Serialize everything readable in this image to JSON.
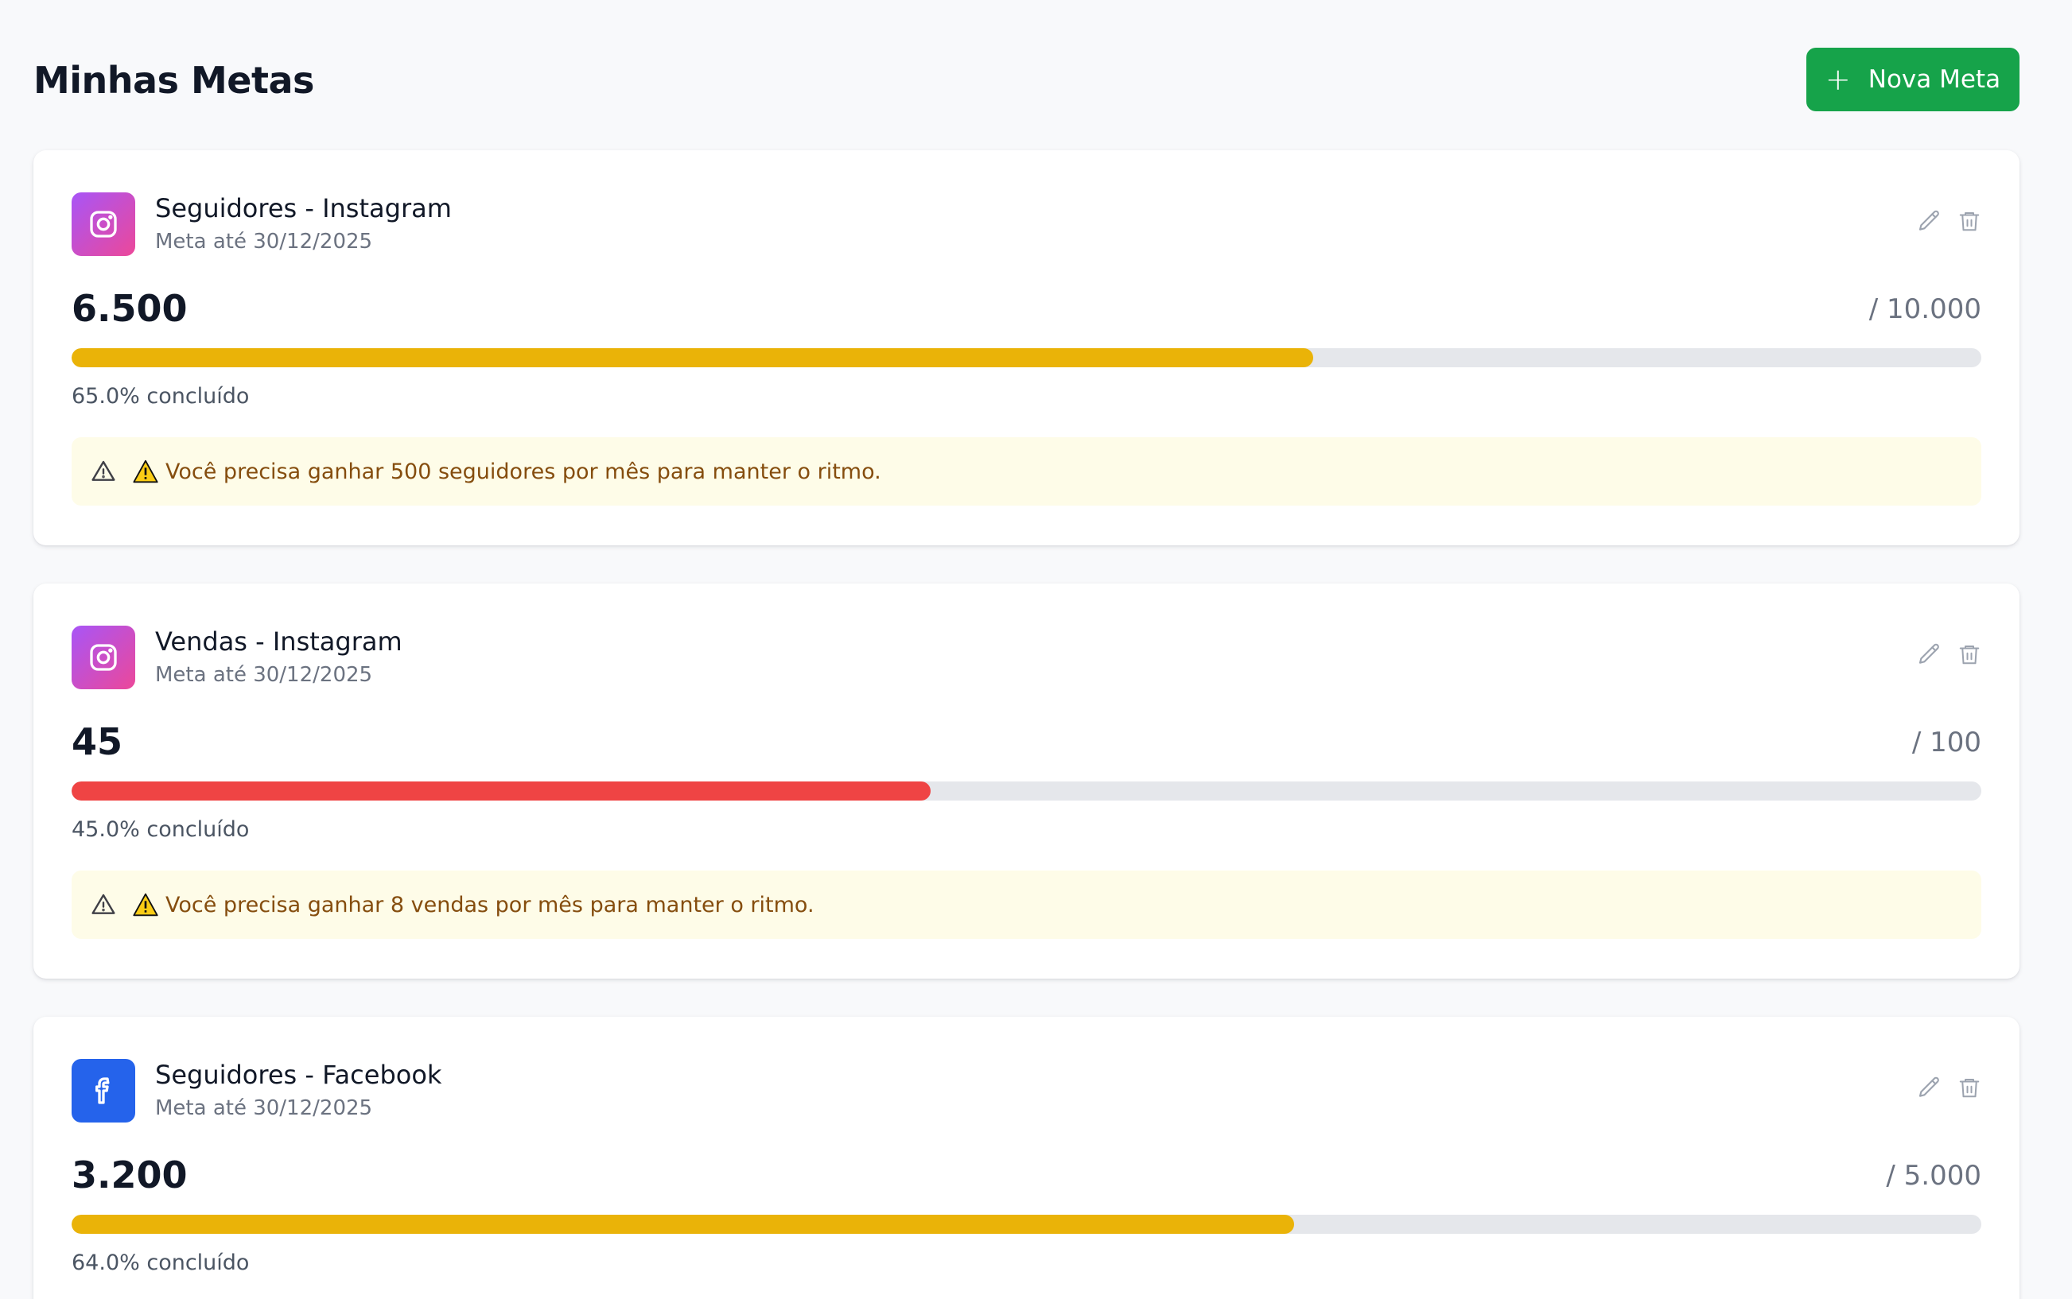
{
  "header": {
    "title": "Minhas Metas",
    "new_button_label": "Nova Meta",
    "new_button_icon": "plus-icon"
  },
  "colors": {
    "primary_green": "#16a34a",
    "progress_yellow": "#eab308",
    "progress_red": "#ef4444",
    "track_gray": "#e5e7eb",
    "alert_bg": "#fefce8",
    "alert_text": "#854d0e",
    "facebook_blue": "#2563eb"
  },
  "goals": [
    {
      "title": "Seguidores - Instagram",
      "subtitle": "Meta até 30/12/2025",
      "platform_icon": "instagram-icon",
      "current": "6.500",
      "target": "/ 10.000",
      "progress": 0.65,
      "progress_color": "#eab308",
      "progress_label": "65.0% concluído",
      "alert": "Você precisa ganhar 500 seguidores por mês para manter o ritmo."
    },
    {
      "title": "Vendas - Instagram",
      "subtitle": "Meta até 30/12/2025",
      "platform_icon": "instagram-icon",
      "current": "45",
      "target": "/ 100",
      "progress": 0.45,
      "progress_color": "#ef4444",
      "progress_label": "45.0% concluído",
      "alert": "Você precisa ganhar 8 vendas por mês para manter o ritmo."
    },
    {
      "title": "Seguidores - Facebook",
      "subtitle": "Meta até 30/12/2025",
      "platform_icon": "facebook-icon",
      "current": "3.200",
      "target": "/ 5.000",
      "progress": 0.64,
      "progress_color": "#eab308",
      "progress_label": "64.0% concluído",
      "alert": ""
    }
  ]
}
